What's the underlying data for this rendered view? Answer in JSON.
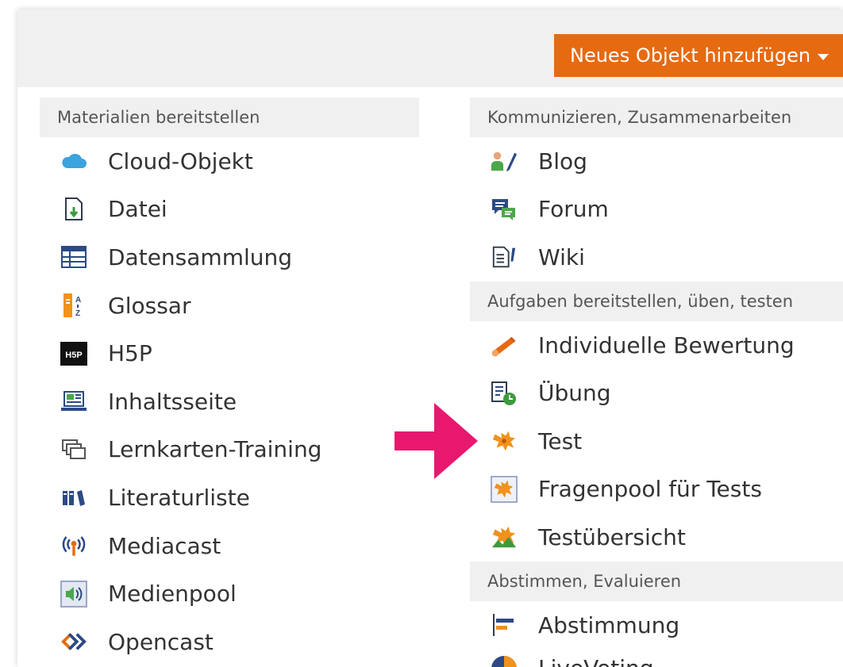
{
  "toolbar": {
    "add_button_label": "Neues Objekt hinzufügen"
  },
  "colors": {
    "accent": "#e66a10",
    "header_bg": "#f0f0f0",
    "arrow": "#e8186e"
  },
  "left_column": {
    "header": "Materialien bereitstellen",
    "items": [
      {
        "label": "Cloud-Objekt",
        "icon": "cloud-icon"
      },
      {
        "label": "Datei",
        "icon": "file-icon"
      },
      {
        "label": "Datensammlung",
        "icon": "table-icon"
      },
      {
        "label": "Glossar",
        "icon": "glossary-icon"
      },
      {
        "label": "H5P",
        "icon": "h5p-icon",
        "icon_text": "H5P"
      },
      {
        "label": "Inhaltsseite",
        "icon": "content-page-icon"
      },
      {
        "label": "Lernkarten-Training",
        "icon": "flashcards-icon"
      },
      {
        "label": "Literaturliste",
        "icon": "bibliography-icon"
      },
      {
        "label": "Mediacast",
        "icon": "mediacast-icon"
      },
      {
        "label": "Medienpool",
        "icon": "mediapool-icon"
      },
      {
        "label": "Opencast",
        "icon": "opencast-icon"
      }
    ]
  },
  "right_column": {
    "groups": [
      {
        "header": "Kommunizieren, Zusammenarbeiten",
        "items": [
          {
            "label": "Blog",
            "icon": "blog-icon"
          },
          {
            "label": "Forum",
            "icon": "forum-icon"
          },
          {
            "label": "Wiki",
            "icon": "wiki-icon"
          }
        ]
      },
      {
        "header": "Aufgaben bereitstellen, üben, testen",
        "items": [
          {
            "label": "Individuelle Bewertung",
            "icon": "individual-assessment-icon"
          },
          {
            "label": "Übung",
            "icon": "exercise-icon"
          },
          {
            "label": "Test",
            "icon": "test-icon"
          },
          {
            "label": "Fragenpool für Tests",
            "icon": "question-pool-icon"
          },
          {
            "label": "Testübersicht",
            "icon": "test-overview-icon"
          }
        ]
      },
      {
        "header": "Abstimmen, Evaluieren",
        "items": [
          {
            "label": "Abstimmung",
            "icon": "poll-icon"
          },
          {
            "label": "LiveVoting",
            "icon": "live-voting-icon"
          }
        ]
      }
    ]
  }
}
